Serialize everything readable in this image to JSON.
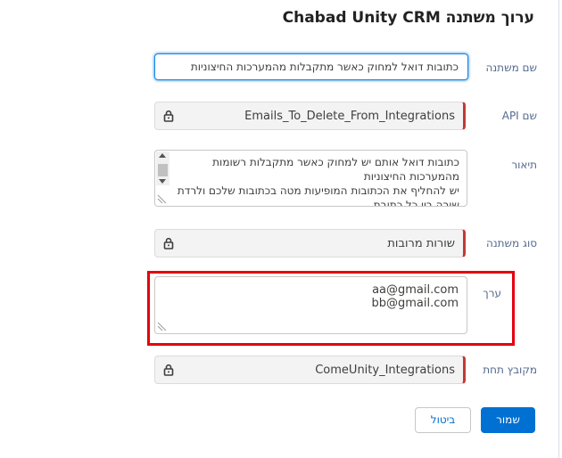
{
  "dialog": {
    "title": "ערוך משתנה Chabad Unity CRM"
  },
  "form": {
    "name": {
      "label": "שם משתנה",
      "value": "כתובות דואל למחוק כאשר מתקבלות מהמערכות החיצוניות"
    },
    "api_name": {
      "label": "שם API",
      "value": "Emails_To_Delete_From_Integrations"
    },
    "description": {
      "label": "תיאור",
      "value": "כתובות דואל אותם יש למחוק כאשר מתקבלות רשומות מהמערכות החיצוניות\nיש להחליף את הכתובות המופיעות מטה בכתובות שלכם ולרדת שורה בין כל כתובת"
    },
    "variable_type": {
      "label": "סוג משתנה",
      "value": "שורות מרובות"
    },
    "value": {
      "label": "ערך",
      "lines": "aa@gmail.com\nbb@gmail.com"
    },
    "group": {
      "label": "מקובץ תחת",
      "value": "ComeUnity_Integrations"
    }
  },
  "buttons": {
    "save": "שמור",
    "cancel": "ביטול"
  },
  "colors": {
    "accent": "#0070d2",
    "required_marker": "#c23934",
    "highlight_box": "#e4000f"
  },
  "icons": {
    "locked_field": "lock-icon",
    "textarea_resize": "resize-handle-icon"
  }
}
